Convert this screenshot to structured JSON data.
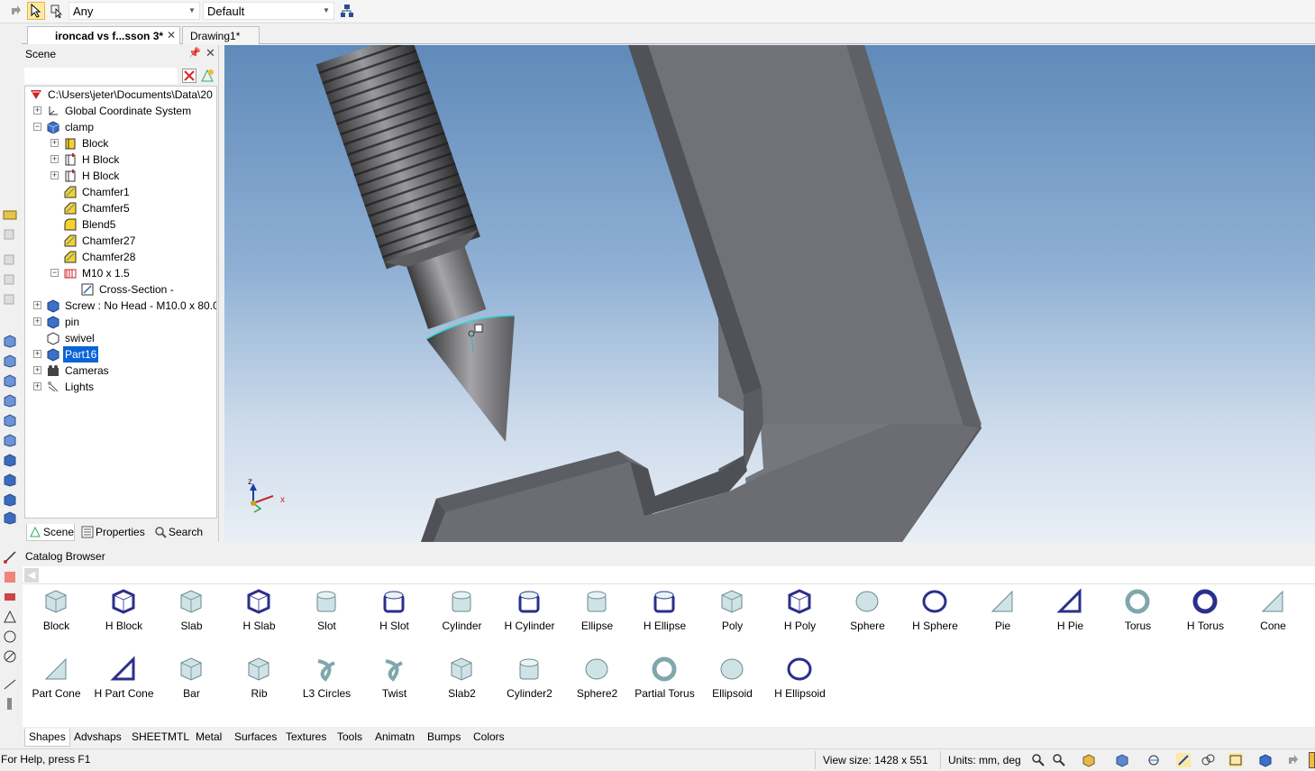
{
  "toolbar": {
    "filter_value": "Any",
    "style_value": "Default"
  },
  "doc_tabs": [
    {
      "label": "ironcad vs f...sson 3*"
    },
    {
      "label": "Drawing1*"
    }
  ],
  "scene": {
    "title": "Scene",
    "search_placeholder": "",
    "tree": [
      {
        "label": "C:\\Users\\jeter\\Documents\\Data\\20",
        "icon": "scene-root-icon"
      },
      {
        "label": "Global Coordinate System",
        "icon": "coordinate-system-icon"
      },
      {
        "label": "clamp",
        "icon": "part-icon"
      },
      {
        "label": "Block",
        "icon": "block-feature-icon"
      },
      {
        "label": "H Block",
        "icon": "hole-block-feature-icon"
      },
      {
        "label": "H Block",
        "icon": "hole-block-feature-icon"
      },
      {
        "label": "Chamfer1",
        "icon": "chamfer-icon"
      },
      {
        "label": "Chamfer5",
        "icon": "chamfer-icon"
      },
      {
        "label": "Blend5",
        "icon": "blend-icon"
      },
      {
        "label": "Chamfer27",
        "icon": "chamfer-icon"
      },
      {
        "label": "Chamfer28",
        "icon": "chamfer-icon"
      },
      {
        "label": "M10 x 1.5",
        "icon": "thread-icon"
      },
      {
        "label": "Cross-Section -",
        "icon": "cross-section-icon"
      },
      {
        "label": "Screw : No Head - M10.0 x 80.0",
        "icon": "part-icon"
      },
      {
        "label": "pin",
        "icon": "part-icon"
      },
      {
        "label": "swivel",
        "icon": "part-outline-icon"
      },
      {
        "label": "Part16",
        "icon": "part-icon"
      },
      {
        "label": "Cameras",
        "icon": "camera-icon"
      },
      {
        "label": "Lights",
        "icon": "light-icon"
      }
    ],
    "bottom_tabs": [
      "Scene",
      "Properties",
      "Search"
    ]
  },
  "viewport": {
    "axis_x": "x",
    "axis_z": "z"
  },
  "catalog": {
    "title": "Catalog Browser",
    "shapes_row1": [
      "Block",
      "H Block",
      "Slab",
      "H Slab",
      "Slot",
      "H Slot",
      "Cylinder",
      "H Cylinder",
      "Ellipse",
      "H Ellipse",
      "Poly",
      "H Poly",
      "Sphere",
      "H Sphere",
      "Pie",
      "H Pie",
      "Torus",
      "H Torus",
      "Cone"
    ],
    "shapes_row2": [
      "Part Cone",
      "H Part Cone",
      "Bar",
      "Rib",
      "L3 Circles",
      "Twist",
      "Slab2",
      "Cylinder2",
      "Sphere2",
      "Partial Torus",
      "Ellipsoid",
      "H Ellipsoid"
    ],
    "tabs": [
      "Shapes",
      "Advshaps",
      "SHEETMTL",
      "Metal",
      "Surfaces",
      "Textures",
      "Tools",
      "Animatn",
      "Bumps",
      "Colors"
    ]
  },
  "status": {
    "help": "For Help, press F1",
    "view_size": "View size: 1428 x  551",
    "units": "Units: mm, deg"
  },
  "colors": {
    "selection": "#0a64d6",
    "viewport_top": "#5f8ab9",
    "viewport_bottom": "#e9eff6",
    "highlight_edge": "#2fd6d6"
  }
}
